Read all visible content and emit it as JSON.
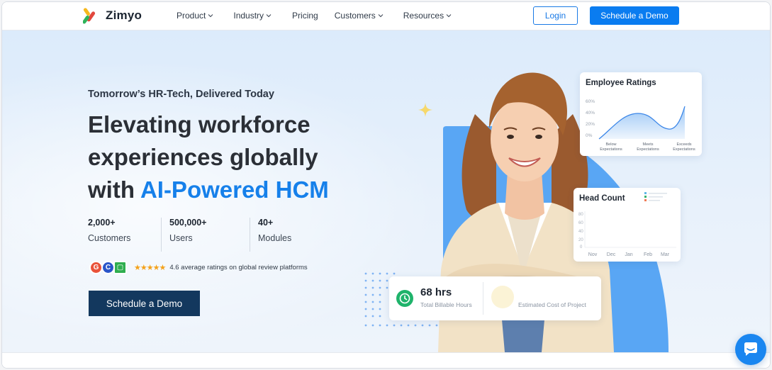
{
  "brand": {
    "name": "Zimyo"
  },
  "nav": {
    "items": [
      {
        "label": "Product",
        "has_dropdown": true
      },
      {
        "label": "Industry",
        "has_dropdown": true
      },
      {
        "label": "Pricing",
        "has_dropdown": false
      },
      {
        "label": "Customers",
        "has_dropdown": true
      },
      {
        "label": "Resources",
        "has_dropdown": true
      }
    ],
    "login_label": "Login",
    "demo_label": "Schedule a Demo"
  },
  "hero": {
    "tagline": "Tomorrow’s HR-Tech, Delivered Today",
    "headline_line1": "Elevating workforce",
    "headline_line2": "experiences globally",
    "headline_prefix": "with ",
    "headline_accent": "AI-Powered HCM",
    "stats": [
      {
        "value": "2,000+",
        "label": "Customers"
      },
      {
        "value": "500,000+",
        "label": "Users"
      },
      {
        "value": "40+",
        "label": "Modules"
      }
    ],
    "rating": {
      "value": 4.6,
      "text": "4.6 average ratings on global review platforms",
      "stars": "★★★★★"
    },
    "cta_label": "Schedule a Demo"
  },
  "cards": {
    "employee_ratings": {
      "title": "Employee Ratings",
      "y_ticks": [
        "60%",
        "40%",
        "20%",
        "0%"
      ],
      "x_labels": [
        [
          "Below",
          "Expectations"
        ],
        [
          "Meets",
          "Expectations"
        ],
        [
          "Exceeds",
          "Expectations"
        ]
      ]
    },
    "head_count": {
      "title": "Head Count",
      "y_ticks": [
        "80",
        "60",
        "40",
        "20",
        "0"
      ],
      "x_labels": [
        "Nov",
        "Dec",
        "Jan",
        "Feb",
        "Mar"
      ]
    },
    "billable": {
      "value": "68 hrs",
      "label": "Total Billable Hours",
      "cost_label": "Estimated Cost of Project"
    }
  },
  "colors": {
    "primary": "#0a7cf0",
    "accent_text": "#1680ea",
    "cta_dark": "#13385e",
    "hero_bg": "#dcebfb"
  }
}
